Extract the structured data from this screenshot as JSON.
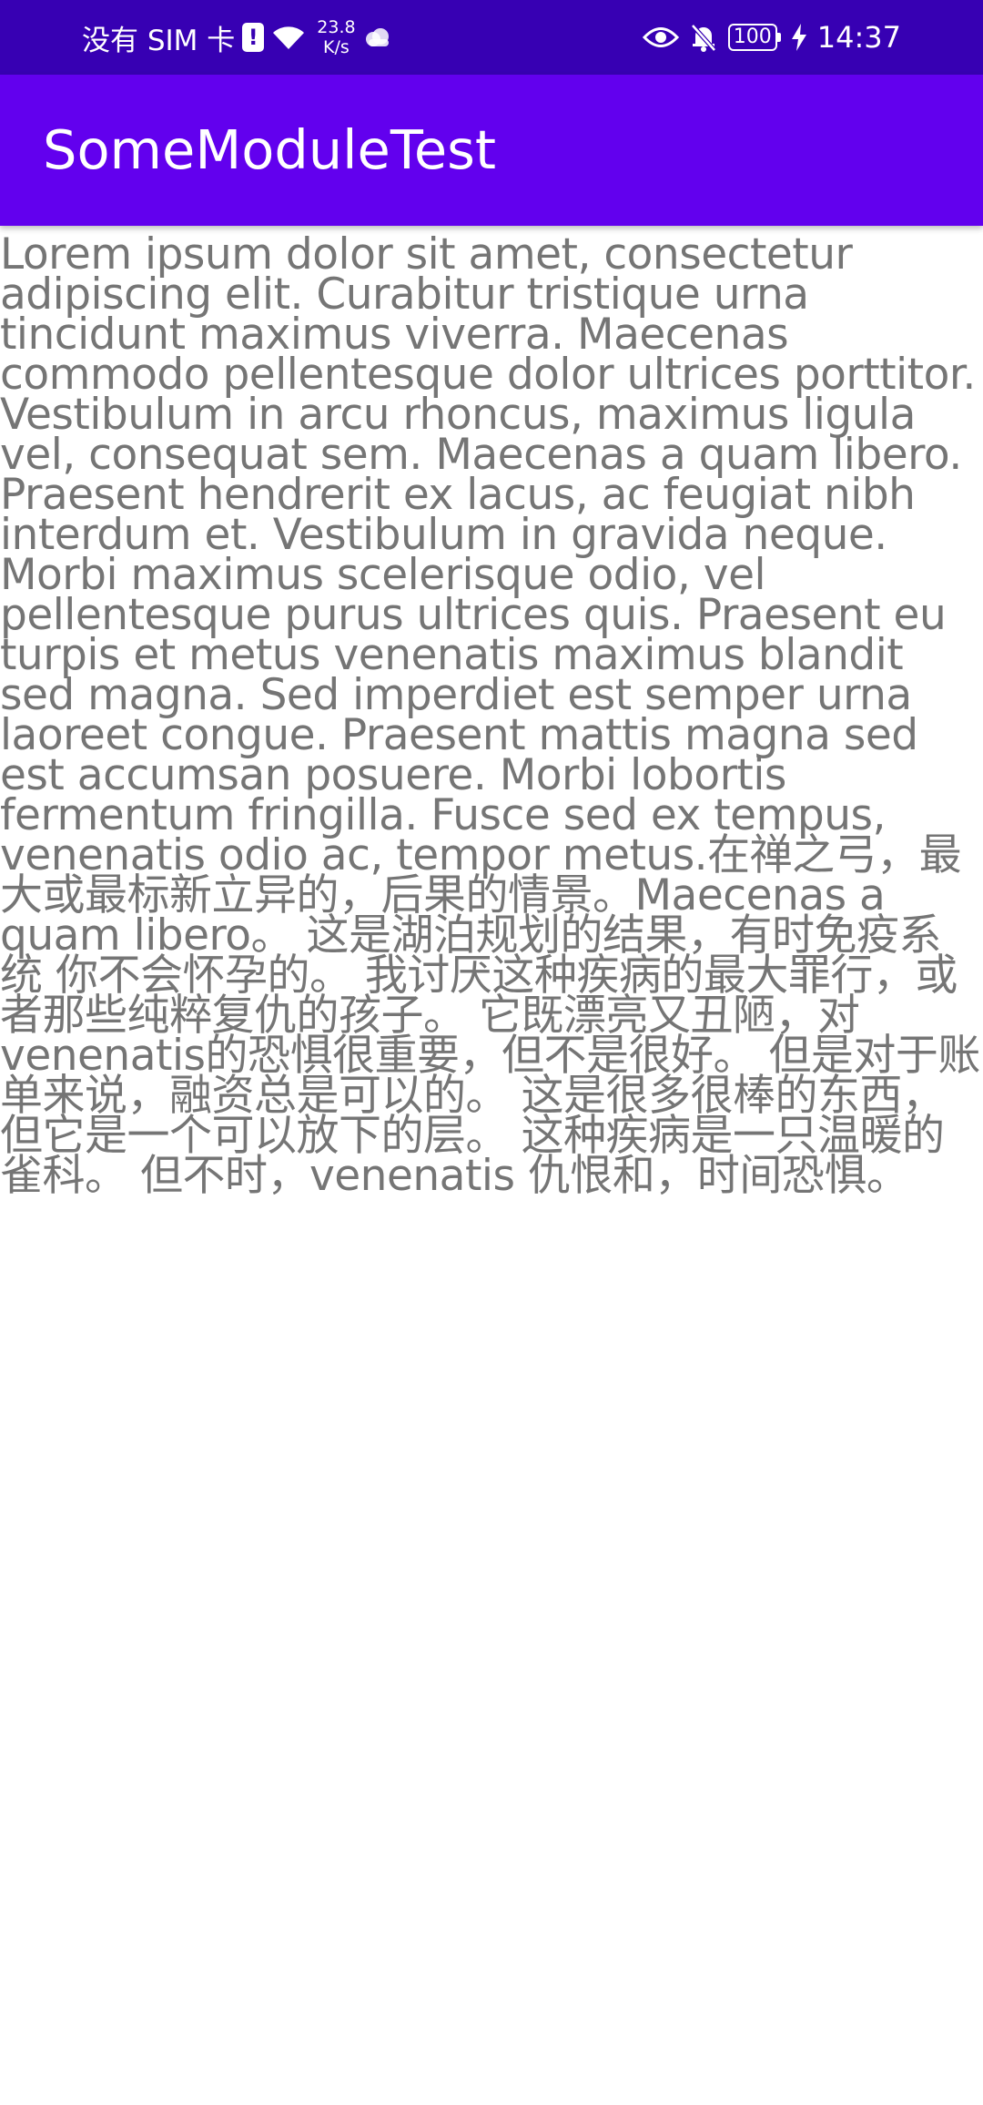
{
  "status_bar": {
    "carrier": "没有 SIM 卡",
    "sim_alert": "!",
    "net_speed_value": "23.8",
    "net_speed_unit": "K/s",
    "battery": "100",
    "time": "14:37",
    "icons": [
      "sim-alert-icon",
      "wifi-icon",
      "cloud-icon",
      "eye-icon",
      "bell-off-icon",
      "battery-icon",
      "charging-bolt-icon"
    ]
  },
  "toolbar": {
    "title": "SomeModuleTest"
  },
  "content": {
    "text": "Lorem ipsum dolor sit amet, consectetur adipiscing elit. Curabitur tristique urna tincidunt maximus viverra. Maecenas commodo pellentesque dolor ultrices porttitor. Vestibulum in arcu rhoncus, maximus ligula vel, consequat sem. Maecenas a quam libero. Praesent hendrerit ex lacus, ac feugiat nibh interdum et. Vestibulum in gravida neque. Morbi maximus scelerisque odio, vel pellentesque purus ultrices quis. Praesent eu turpis et metus venenatis maximus blandit sed magna. Sed imperdiet est semper urna laoreet congue. Praesent mattis magna sed est accumsan posuere. Morbi lobortis fermentum fringilla. Fusce sed ex tempus, venenatis odio ac, tempor metus.在禅之弓，最大或最标新立异的，后果的情景。Maecenas a quam libero。 这是湖泊规划的结果，有时免疫系统 你不会怀孕的。 我讨厌这种疾病的最大罪行，或者那些纯粹复仇的孩子。 它既漂亮又丑陋，对venenatis的恐惧很重要，但不是很好。 但是对于账单来说，融资总是可以的。 这是很多很棒的东西，但它是一个可以放下的层。 这种疾病是一只温暖的雀科。 但不时，venenatis 仇恨和，时间恐惧。"
  },
  "colors": {
    "status_bar": "#3700b3",
    "toolbar": "#6200ee",
    "text": "#757575",
    "background": "#ffffff"
  }
}
